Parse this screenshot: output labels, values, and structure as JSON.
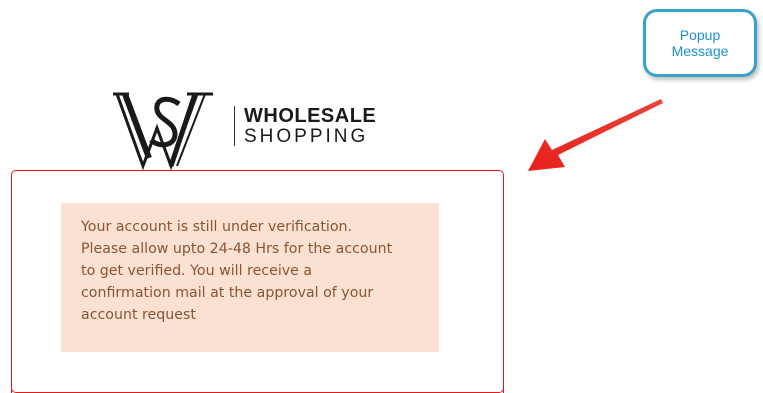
{
  "logo": {
    "word_line_1": "WHOLESALE",
    "word_line_2": "SHOPPING",
    "mark_icon": "ws-monogram-icon"
  },
  "notice": {
    "message": "Your account is still under verification.\nPlease allow upto 24-48 Hrs for the account\nto get verified. You will receive a\nconfirmation mail at the approval of your\naccount request"
  },
  "callout": {
    "text": "Popup\nMessage"
  },
  "colors": {
    "panel_border": "#e11b1b",
    "notice_bg": "#fbe1d2",
    "notice_text": "#8a5430",
    "callout_border": "#3aa2c9",
    "callout_text": "#1e90c8",
    "arrow": "#e8201a"
  }
}
